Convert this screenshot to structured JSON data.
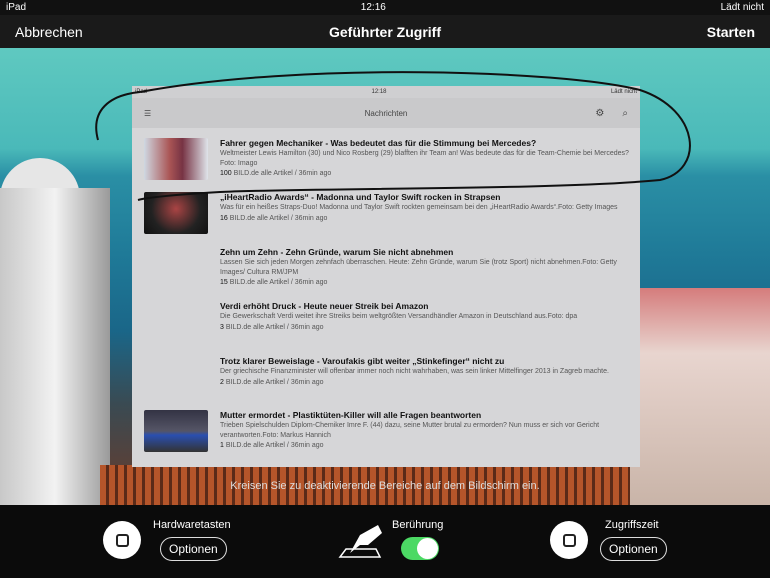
{
  "status": {
    "device": "iPad",
    "time": "12:16",
    "battery": "Lädt nicht"
  },
  "nav": {
    "cancel": "Abbrechen",
    "title": "Geführter Zugriff",
    "start": "Starten"
  },
  "screenshot": {
    "status": {
      "device": "iPad",
      "time": "12:18",
      "battery": "Lädt nicht"
    },
    "title": "Nachrichten",
    "articles": [
      {
        "title": "Fahrer gegen Mechaniker - Was bedeutet das für die Stimmung bei Mercedes?",
        "desc": "Weltmeister Lewis Hamilton (30) und Nico Rosberg (29) blafften ihr Team an! Was bedeute das für die Team-Chemie bei Mercedes?Foto: Imago",
        "count": "100",
        "meta": " BILD.de alle Artikel / 36min ago"
      },
      {
        "title": "„iHeartRadio Awards“ - Madonna und Taylor Swift rocken in Strapsen",
        "desc": "Was für ein heißes Straps-Duo! Madonna und Taylor Swift rockten gemeinsam bei den „iHeartRadio Awards“.Foto: Getty Images",
        "count": "16",
        "meta": " BILD.de alle Artikel / 36min ago"
      },
      {
        "title": "Zehn um Zehn - Zehn Gründe, warum Sie nicht abnehmen",
        "desc": "Lassen Sie sich jeden Morgen zehnfach überraschen. Heute: Zehn Gründe, warum Sie (trotz Sport) nicht abnehmen.Foto: Getty Images/ Cultura RM/JPM",
        "count": "15",
        "meta": " BILD.de alle Artikel / 36min ago"
      },
      {
        "title": "Verdi erhöht Druck - Heute neuer Streik bei Amazon",
        "desc": "Die Gewerkschaft Verdi weitet ihre Streiks beim weltgrößten Versandhändler Amazon in Deutschland aus.Foto: dpa",
        "count": "3",
        "meta": " BILD.de alle Artikel / 36min ago"
      },
      {
        "title": "Trotz klarer Beweislage - Varoufakis gibt weiter „Stinkefinger“ nicht zu",
        "desc": "Der griechische Finanzminister will offenbar immer noch nicht wahrhaben, was sein linker Mittelfinger 2013 in Zagreb machte.",
        "count": "2",
        "meta": " BILD.de alle Artikel / 36min ago"
      },
      {
        "title": "Mutter ermordet - Plastiktüten-Killer will alle Fragen beantworten",
        "desc": "Trieben Spielschulden Diplom-Chemiker Imre F. (44) dazu, seine Mutter brutal zu ermorden? Nun muss er sich vor Gericht verantworten.Foto: Markus Hannich",
        "count": "1",
        "meta": " BILD.de alle Artikel / 36min ago"
      }
    ]
  },
  "hint": "Kreisen Sie zu deaktivierende Bereiche auf dem Bildschirm ein.",
  "bottom": {
    "hardware_label": "Hardwaretasten",
    "hardware_options": "Optionen",
    "touch_label": "Berührung",
    "touch_on": true,
    "time_label": "Zugriffszeit",
    "time_options": "Optionen"
  },
  "colors": {
    "toggle": "#4cd964"
  }
}
